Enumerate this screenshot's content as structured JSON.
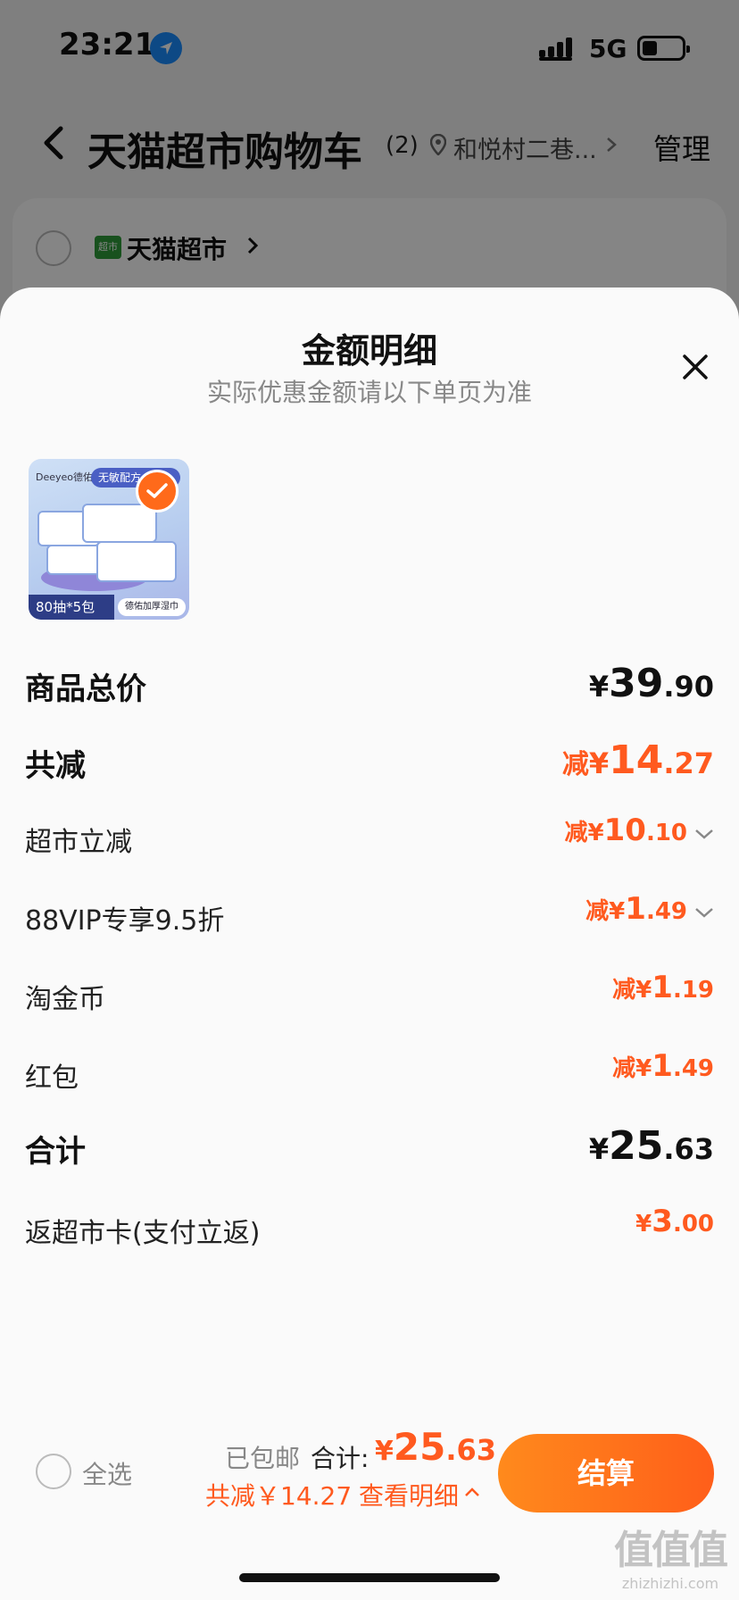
{
  "status_bar": {
    "time": "23:21",
    "network": "5G"
  },
  "nav": {
    "title": "天猫超市购物车",
    "count": "(2)",
    "address": "和悦村二巷...",
    "manage_label": "管理"
  },
  "store": {
    "name": "天猫超市",
    "logo_text": "超市"
  },
  "sheet": {
    "title": "金额明细",
    "subtitle": "实际优惠金额请以下单页为准",
    "product": {
      "brand": "Deeyeo德佑",
      "tag": "无敏配方 安心",
      "spec": "80抽*5包",
      "name": "德佑加厚湿巾"
    },
    "rows": [
      {
        "label": "商品总价",
        "prefix": "",
        "yen": "¥",
        "int": "39",
        "dec": ".90"
      },
      {
        "label": "共减",
        "prefix": "减",
        "yen": "¥",
        "int": "14",
        "dec": ".27"
      },
      {
        "label": "超市立减",
        "prefix": "减",
        "yen": "¥",
        "int": "10",
        "dec": ".10"
      },
      {
        "label": "88VIP专享9.5折",
        "prefix": "减",
        "yen": "¥",
        "int": "1",
        "dec": ".49"
      },
      {
        "label": "淘金币",
        "prefix": "减",
        "yen": "¥",
        "int": "1",
        "dec": ".19"
      },
      {
        "label": "红包",
        "prefix": "减",
        "yen": "¥",
        "int": "1",
        "dec": ".49"
      },
      {
        "label": "合计",
        "prefix": "",
        "yen": "¥",
        "int": "25",
        "dec": ".63"
      },
      {
        "label": "返超市卡(支付立返)",
        "prefix": "",
        "yen": "¥",
        "int": "3",
        "dec": ".00"
      }
    ]
  },
  "bottom_bar": {
    "select_all_label": "全选",
    "shipping_label": "已包邮",
    "total_label": "合计:",
    "total_yen": "¥",
    "total_int": "25",
    "total_dec": ".63",
    "save_text": "共减￥14.27",
    "detail_label": "查看明细",
    "checkout_label": "结算"
  },
  "watermark": {
    "big": "值值值",
    "small": "zhizhizhi.com"
  },
  "colors": {
    "accent": "#ff5a1f",
    "checkout_start": "#ff8a1c",
    "checkout_end": "#ff5e1a",
    "location_blue": "#1a8cff"
  },
  "icons": [
    "location-arrow-icon",
    "signal-icon",
    "battery-icon",
    "back-icon",
    "map-pin-icon",
    "chevron-right-icon",
    "close-icon",
    "check-icon",
    "chevron-down-icon",
    "chevron-up-icon"
  ]
}
